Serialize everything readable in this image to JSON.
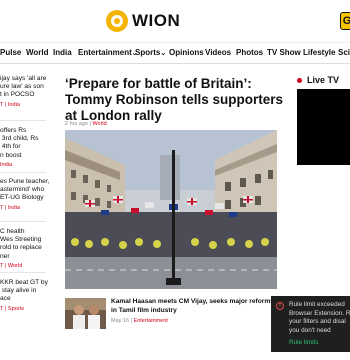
{
  "header": {
    "logo_text": "WION",
    "brand_color": "#f5b400",
    "right_button_label": "G"
  },
  "nav": {
    "items": [
      {
        "label": "Pulse"
      },
      {
        "label": "World"
      },
      {
        "label": "India"
      },
      {
        "label": "Entertainment",
        "has_dropdown": true
      },
      {
        "label": "Sports",
        "has_dropdown": true
      },
      {
        "label": "Opinions"
      },
      {
        "label": "Videos"
      },
      {
        "label": "Photos"
      },
      {
        "label": "TV Show"
      },
      {
        "label": "Lifestyle"
      },
      {
        "label": "Scie"
      }
    ],
    "dropdown_glyph": "⌄"
  },
  "left_column": {
    "items": [
      {
        "title": "ijay says 'all are\nure law' as son\nt in POCSO",
        "meta": "T | India"
      },
      {
        "title": "offers Rs\n 3rd child, Rs\n 4th for\nn boost",
        "meta": "India"
      },
      {
        "title": "es Pune teacher,\nastermind' who\nET-UG Biology",
        "meta": "T | India"
      },
      {
        "title": "C health\nWes Streeting\nrold to replace\nner",
        "meta": "T | World"
      },
      {
        "title": "KKR beat GT by\n stay alive in\nace",
        "meta": "T | Sports"
      }
    ]
  },
  "article": {
    "title": "‘Prepare for battle of Britain’: Tommy Robinson tells supporters at London rally",
    "time": "2 hrs ago",
    "separator": " | ",
    "category": "World"
  },
  "related": {
    "title": "Kamal Haasan meets CM Vijay, seeks major reforms in Tamil film industry",
    "date": "May 16",
    "separator": " | ",
    "category": "Entertainment"
  },
  "live_tv": {
    "label": "Live TV",
    "accent": "#d0021b"
  },
  "toast": {
    "message": "Rule limit exceeded\nBrowser Extension. R\nyour filters and disal\nyou don't need",
    "link_label": "Rule limits",
    "link_color": "#2fbf71"
  }
}
